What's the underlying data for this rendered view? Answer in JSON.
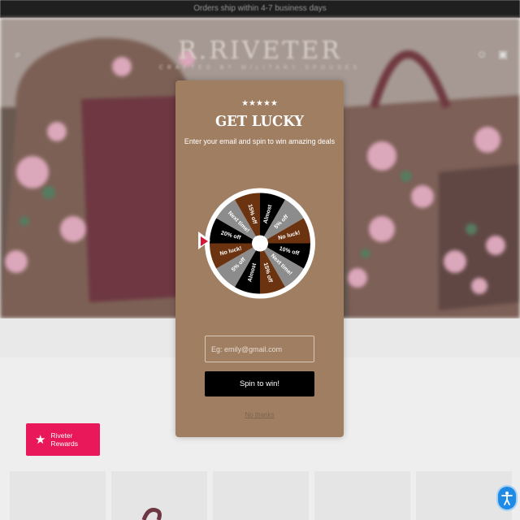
{
  "announcement": "Orders ship within 4-7 business days",
  "brand": {
    "name": "R.RIVETER",
    "tagline": "CRAFTED BY MILITARY SPOUSES"
  },
  "header_icons": [
    "search-icon",
    "account-icon",
    "cart-icon"
  ],
  "popup": {
    "stars": "★★★★★",
    "title": "GET LUCKY",
    "subtitle": "Enter your email and spin to win amazing deals",
    "email_placeholder": "Eg: emily@gmail.com",
    "spin_button": "Spin to win!",
    "dismiss": "No thanks"
  },
  "wheel": {
    "slices": [
      "Almost",
      "5% off",
      "No luck!",
      "10% off",
      "Next time!",
      "15% off",
      "Almost",
      "5% off",
      "No luck!",
      "20% off",
      "Next time!",
      "15% off"
    ],
    "colors": [
      "#000000",
      "#8c8c8c",
      "#6b3310",
      "#000000",
      "#8c8c8c",
      "#6b3310",
      "#000000",
      "#8c8c8c",
      "#6b3310",
      "#000000",
      "#8c8c8c",
      "#6b3310"
    ]
  },
  "rewards_button": "Riveter Rewards",
  "colors": {
    "popup_bg": "#a07e62",
    "spin_button_bg": "#000000",
    "rewards_bg": "#e9185a",
    "accessibility_bg": "#1f8ae6"
  }
}
